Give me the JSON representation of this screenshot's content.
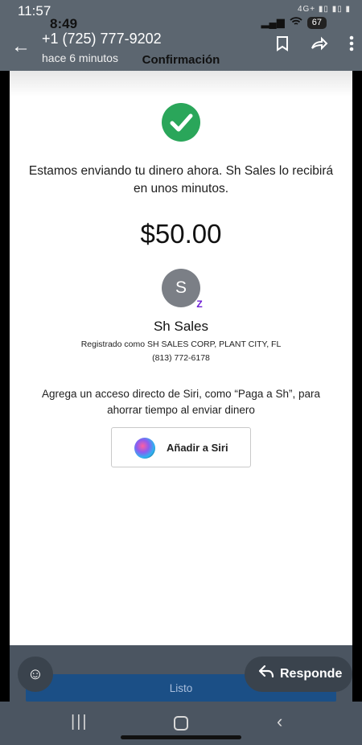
{
  "outer_status": {
    "time": "11:57",
    "icons_text": "4G+ ▮▯ ▮▯ ▮"
  },
  "viewer_header": {
    "sender_phone": "+1 (725) 777-9202",
    "sent_time": "hace 6 minutos",
    "back_icon": "arrow-left-icon",
    "actions": [
      "bookmark-icon",
      "forward-icon",
      "more-vert-icon"
    ]
  },
  "inner_status": {
    "time": "8:49",
    "battery": "67"
  },
  "screen": {
    "title": "Confirmación",
    "message": "Estamos enviando tu dinero ahora. Sh Sales lo recibirá en unos minutos.",
    "amount": "$50.00",
    "avatar_initial": "S",
    "badge_glyph": "Z",
    "recipient_name": "Sh Sales",
    "registered_as": "Registrado como SH SALES CORP, PLANT CITY, FL",
    "recipient_phone": "(813) 772-6178",
    "siri_prompt": "Agrega un acceso directo de Siri, como “Paga a Sh”, para ahorrar tiempo al enviar dinero",
    "siri_button": "Añadir a Siri",
    "done_button": "Listo"
  },
  "overlay": {
    "reply_label": "Responde"
  },
  "colors": {
    "success_green": "#2aa65a",
    "zelle_purple": "#6d1ed4",
    "done_blue": "#1b4f86",
    "chrome_gray": "#5c6670"
  }
}
